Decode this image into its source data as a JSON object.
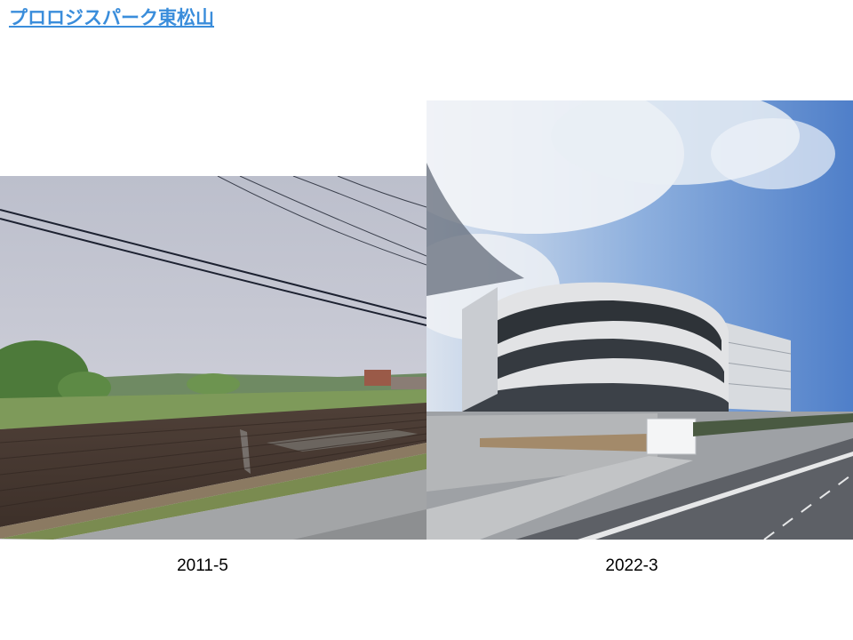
{
  "title": {
    "text": "プロロジスパーク東松山"
  },
  "photos": [
    {
      "caption": "2011-5",
      "subject": "tilled-farmland-with-power-lines"
    },
    {
      "caption": "2022-3",
      "subject": "curved-logistics-warehouse"
    }
  ]
}
